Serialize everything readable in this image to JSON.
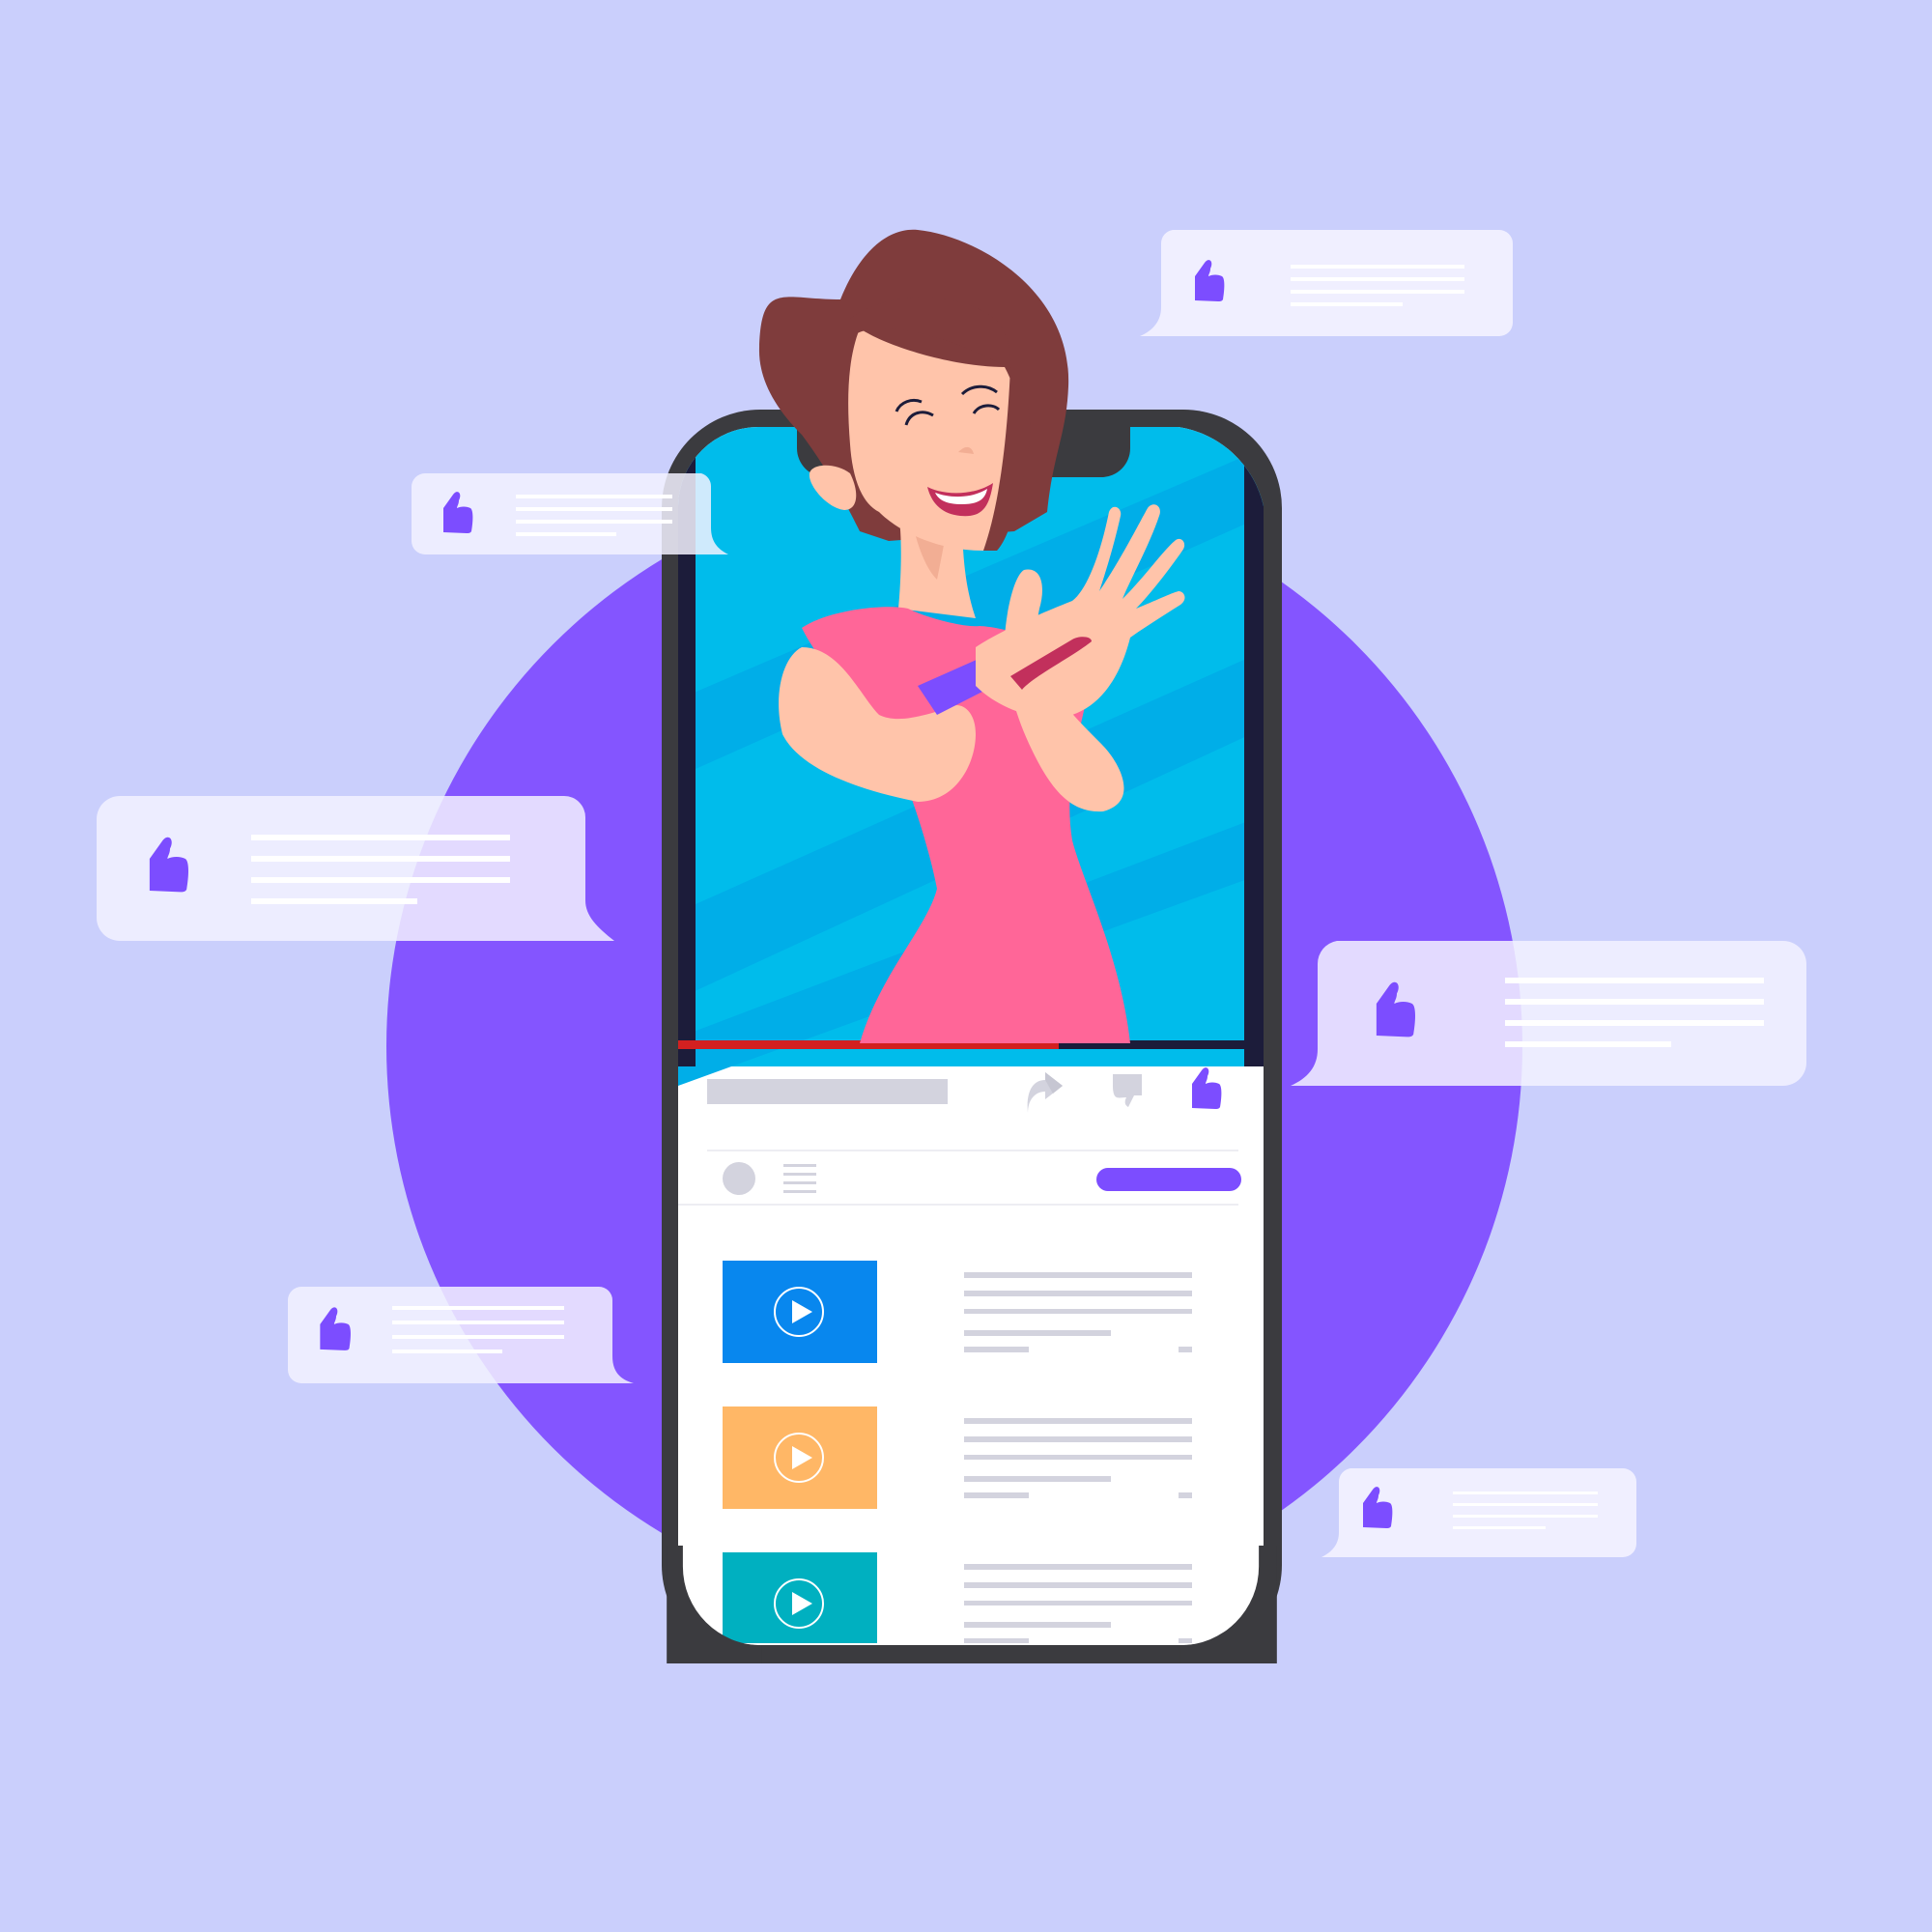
{
  "colors": {
    "background": "#CACFFC",
    "circle": "#8455FF",
    "accent": "#7C4DFF",
    "phone_frame": "#3B3B3F",
    "screen": "#FFFFFF",
    "video_bg": "#00BCEB",
    "video_stripe": "#00AEE8",
    "progress_played": "#D32020",
    "progress_rest": "#1C1C3A",
    "placeholder": "#D3D3DE",
    "bubble_fill": "#F3F2FF",
    "thumb_blue": "#0887EE",
    "thumb_orange": "#FFB766",
    "thumb_teal": "#00B0C0",
    "hair": "#7F3C3C",
    "skin": "#FFC4AA",
    "dress": "#FF6698"
  },
  "icons": {
    "like": "thumbs-up-icon",
    "dislike": "thumbs-down-icon",
    "share": "share-arrow-icon",
    "play": "play-icon",
    "avatar": "avatar-icon",
    "menu": "menu-lines-icon"
  },
  "video": {
    "progress": 0.65
  },
  "playlist": [
    {
      "thumbnail_color": "#0887EE"
    },
    {
      "thumbnail_color": "#FFB766"
    },
    {
      "thumbnail_color": "#00B0C0"
    }
  ],
  "comment_bubbles": [
    {
      "tail": "left"
    },
    {
      "tail": "right"
    },
    {
      "tail": "right"
    },
    {
      "tail": "left"
    },
    {
      "tail": "right"
    },
    {
      "tail": "left"
    }
  ]
}
